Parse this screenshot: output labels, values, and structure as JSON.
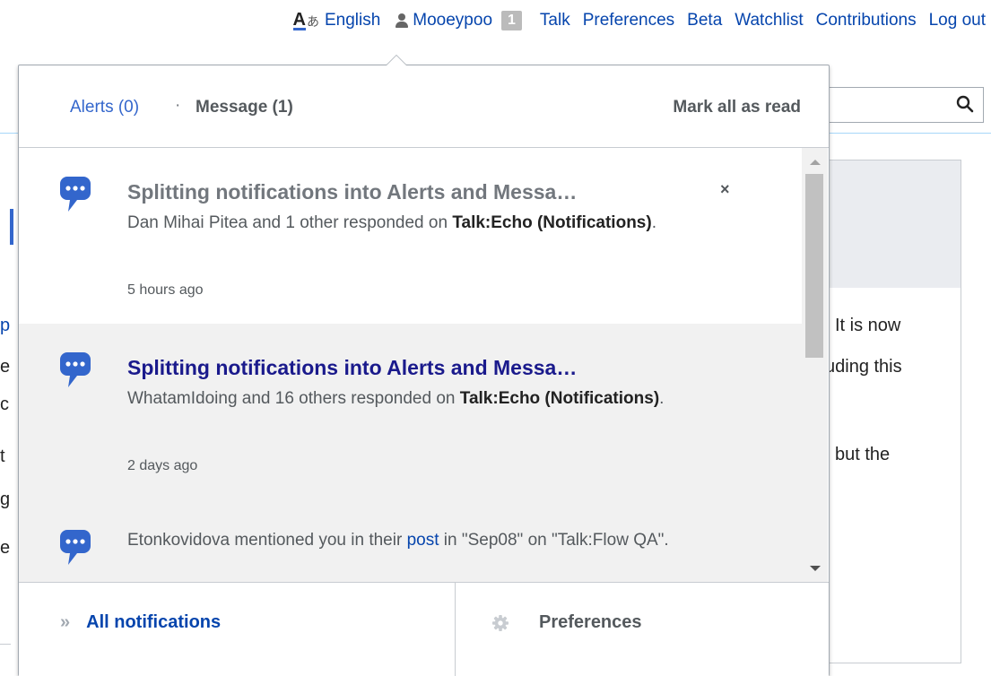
{
  "personal_bar": {
    "uls_letter": "A",
    "uls_script": "あ",
    "language": "English",
    "username": "Mooeypoo",
    "notification_count": "1",
    "links": [
      "Talk",
      "Preferences",
      "Beta",
      "Watchlist",
      "Contributions",
      "Log out"
    ]
  },
  "background": {
    "right_text": [
      "It is now",
      "uding this",
      "but the"
    ]
  },
  "popup": {
    "tabs": {
      "alerts": "Alerts (0)",
      "separator": "·",
      "messages": "Message (1)"
    },
    "mark_all_read": "Mark all as read",
    "items": [
      {
        "title": "Splitting notifications into Alerts and Messa…",
        "body_pre": "Dan Mihai Pitea and 1 other responded on ",
        "body_bold": "Talk:Echo (Notifications)",
        "body_post": ".",
        "time": "5 hours ago",
        "close": "×"
      },
      {
        "title": "Splitting notifications into Alerts and Messa…",
        "body_pre": "WhatamIdoing and 16 others responded on ",
        "body_bold": "Talk:Echo (Notifications)",
        "body_post": ".",
        "time": "2 days ago"
      },
      {
        "body_pre": "Etonkovidova mentioned you in their ",
        "body_link": "post",
        "body_post": " in \"Sep08\" on \"Talk:Flow QA\"."
      }
    ],
    "footer": {
      "all_notifications": "All notifications",
      "preferences": "Preferences"
    }
  },
  "colors": {
    "link": "#0645ad",
    "unread_title": "#72777d",
    "read_title": "#1a1a8c",
    "bubble": "#3366cc",
    "badge": "#bbbbbb"
  },
  "icons": [
    "uls-icon",
    "user-icon",
    "search-icon",
    "speech-bubble-icon",
    "close-icon",
    "double-chevron-icon",
    "gear-icon",
    "scroll-up-icon",
    "scroll-down-icon"
  ]
}
